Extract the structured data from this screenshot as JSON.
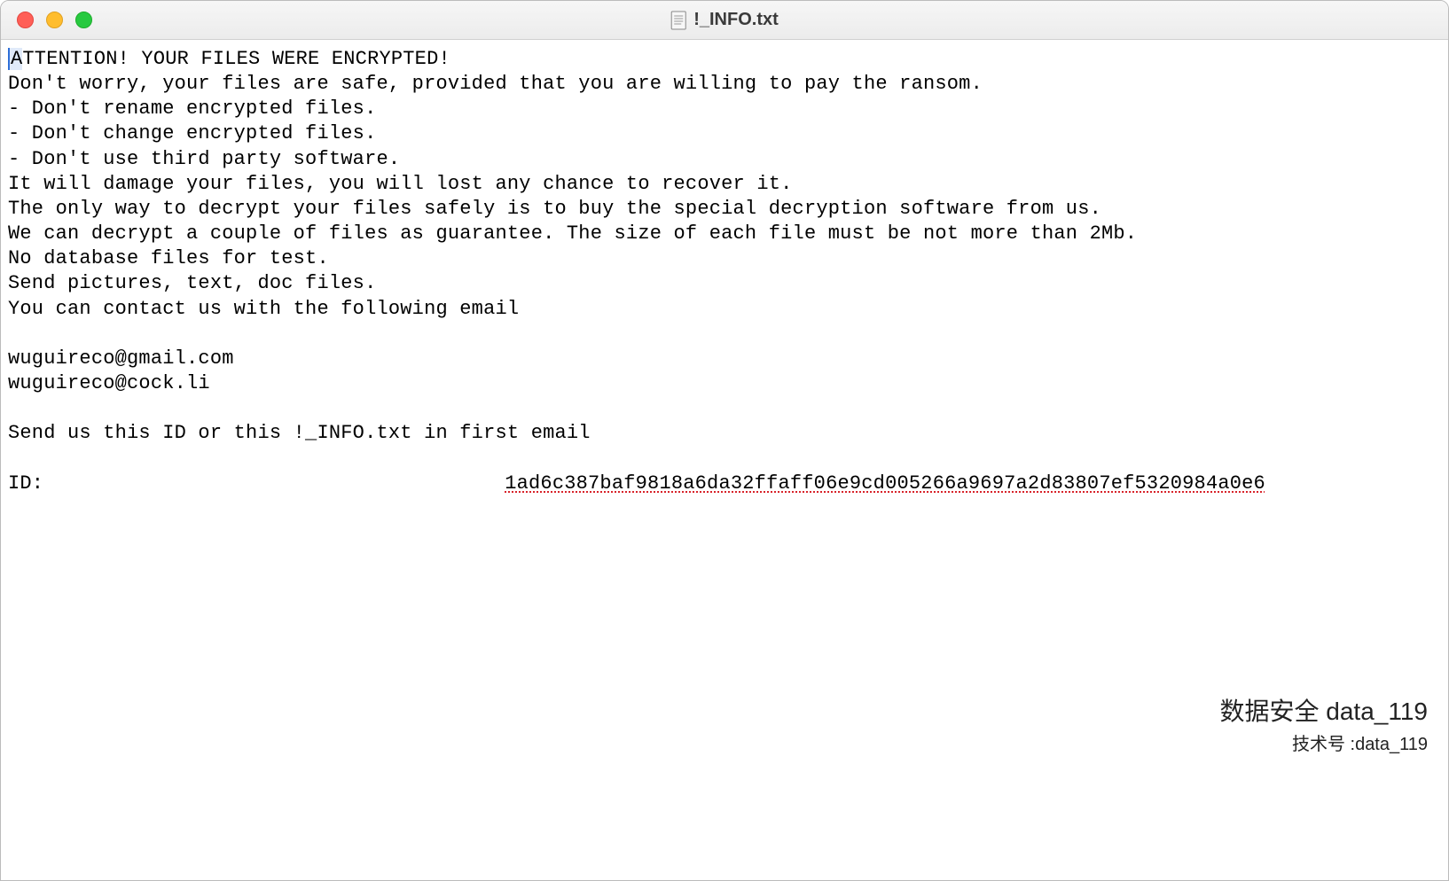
{
  "window": {
    "title": "!_INFO.txt"
  },
  "content": {
    "line1_firstchar": "A",
    "line1_rest": "TTENTION! YOUR FILES WERE ENCRYPTED!",
    "line2": "Don't worry, your files are safe, provided that you are willing to pay the ransom.",
    "line3": "- Don't rename encrypted files.",
    "line4": "- Don't change encrypted files.",
    "line5": "- Don't use third party software.",
    "line6": "It will damage your files, you will lost any chance to recover it.",
    "line7": "The only way to decrypt your files safely is to buy the special decryption software from us.",
    "line8": "We can decrypt a couple of files as guarantee. The size of each file must be not more than 2Mb.",
    "line9": "No database files for test.",
    "line10": "Send pictures, text, doc files.",
    "line11": "You can contact us with the following email",
    "email1": "wuguireco@gmail.com",
    "email2": "wuguireco@cock.li",
    "line14": "Send us this ID or this !_INFO.txt in first email",
    "id_label": "ID:",
    "id_value": "1ad6c387baf9818a6da32ffaff06e9cd005266a9697a2d83807ef5320984a0e6"
  },
  "watermark": {
    "main": "数据安全 data_119",
    "sub": "技术号 :data_119"
  }
}
